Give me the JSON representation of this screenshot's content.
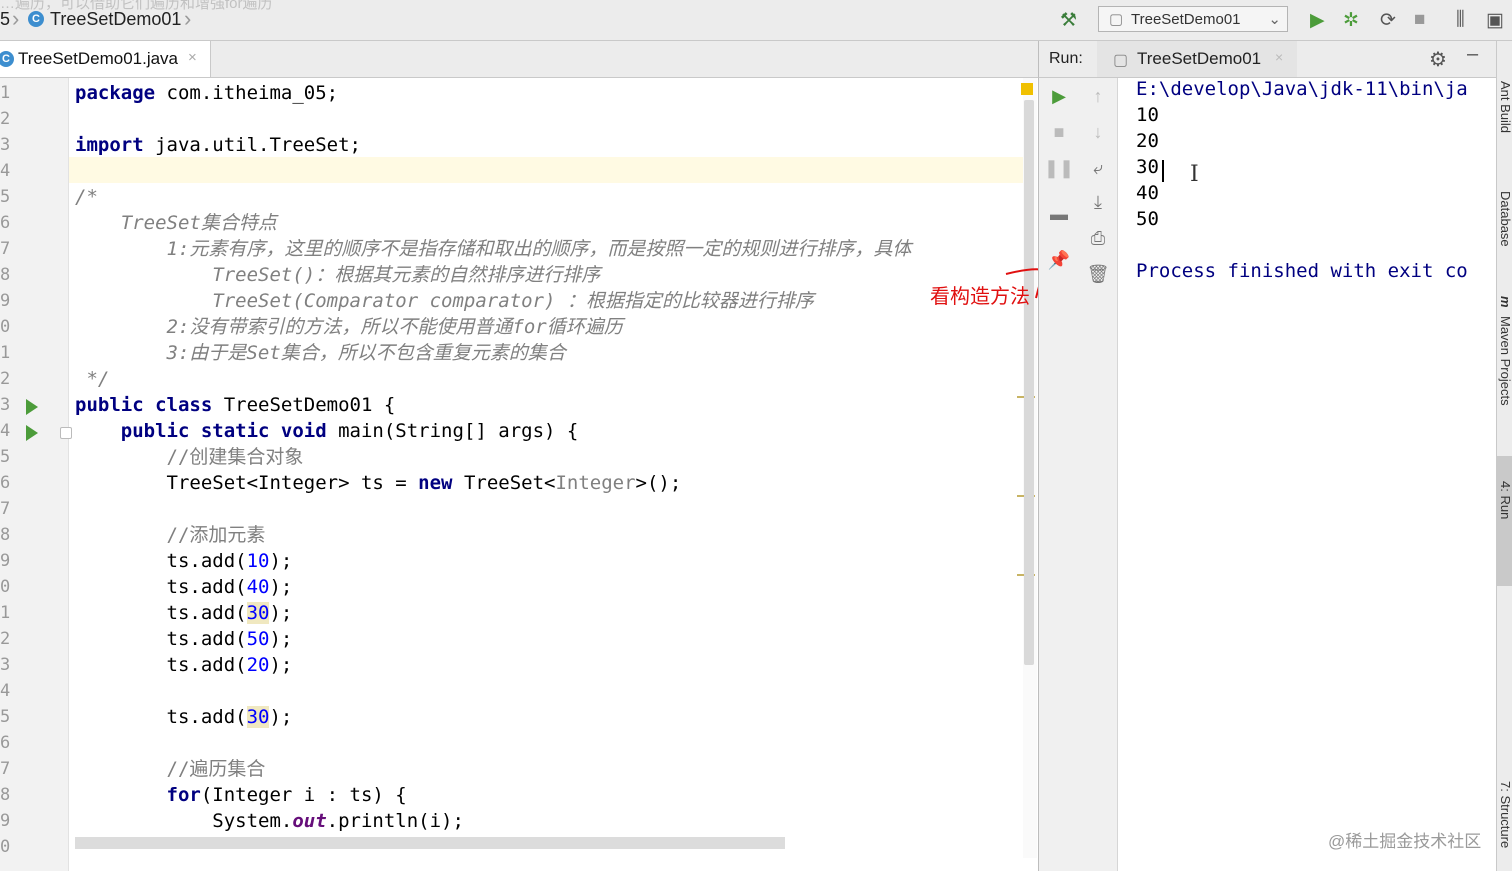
{
  "nav": {
    "breadcrumb_prefix": "5",
    "breadcrumb_class": "TreeSetDemo01",
    "run_config": "TreeSetDemo01",
    "overlay_text": "…遍历，可以借助它们遍历和增强for遍历"
  },
  "editor": {
    "tab_label": "TreeSetDemo01.java",
    "line_numbers": [
      "1",
      "2",
      "3",
      "4",
      "5",
      "6",
      "7",
      "8",
      "9",
      "0",
      "1",
      "2",
      "3",
      "4",
      "5",
      "6",
      "7",
      "8",
      "9",
      "0",
      "1",
      "2",
      "3",
      "4",
      "5",
      "6",
      "7",
      "8",
      "9",
      "0"
    ],
    "code": {
      "l1_kw": "package",
      "l1_rest": " com.itheima_05;",
      "l3_kw": "import",
      "l3_rest": " java.util.TreeSet;",
      "l5": "/*",
      "l6": "    TreeSet集合特点",
      "l7": "        1:元素有序，这里的顺序不是指存储和取出的顺序，而是按照一定的规则进行排序，具体",
      "l8": "            TreeSet()：根据其元素的自然排序进行排序",
      "l9": "            TreeSet(Comparator comparator) ：根据指定的比较器进行排序",
      "l10": "        2:没有带索引的方法，所以不能使用普通for循环遍历",
      "l11": "        3:由于是Set集合，所以不包含重复元素的集合",
      "l12": " */",
      "l13_kw": "public class",
      "l13_rest": " TreeSetDemo01 {",
      "l14_kw": "    public static void",
      "l14_rest": " main(String[] args) {",
      "l15": "        //创建集合对象",
      "l16_a": "        TreeSet<Integer> ts = ",
      "l16_kw": "new",
      "l16_b": " TreeSet<",
      "l16_ge": "Integer",
      "l16_c": ">();",
      "l18": "        //添加元素",
      "add_prefix": "        ts.add(",
      "add_suffix": ");",
      "add_values": [
        "10",
        "40",
        "30",
        "50",
        "20"
      ],
      "add_dup": "30",
      "l26": "        //遍历集合",
      "l27_kw": "        for",
      "l27_rest": "(Integer i : ts) {",
      "l28_a": "            System.",
      "l28_st": "out",
      "l28_b": ".println(i);",
      "l29": "        }"
    },
    "annotation": "看构造方法"
  },
  "run": {
    "label": "Run:",
    "tab_label": "TreeSetDemo01",
    "output_lines": [
      "E:\\develop\\Java\\jdk-11\\bin\\ja",
      "10",
      "20",
      "30",
      "40",
      "50",
      "",
      "Process finished with exit co"
    ]
  },
  "right_tools": [
    "Ant Build",
    "Database",
    "m",
    "Maven Projects",
    "4: Run",
    "7: Structure"
  ],
  "watermark": "@稀土掘金技术社区"
}
